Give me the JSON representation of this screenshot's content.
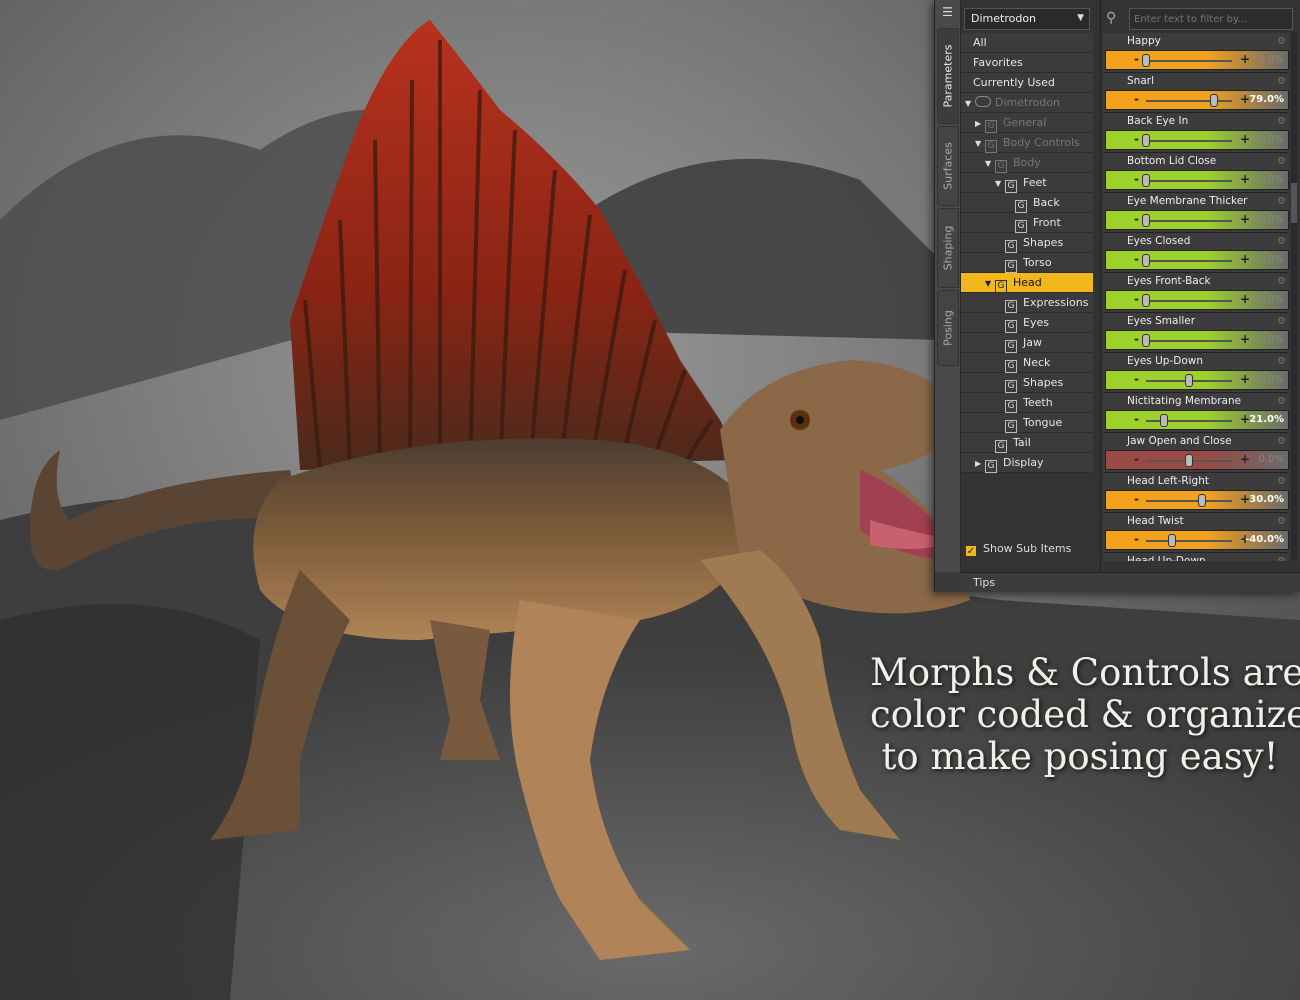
{
  "panel": {
    "tabs": [
      "Parameters",
      "Surfaces",
      "Shaping",
      "Posing"
    ],
    "figure_select": "Dimetrodon",
    "filter_placeholder": "Enter text to filter by...",
    "tree": [
      {
        "label": "All",
        "depth": 0,
        "arrow": "",
        "icon": "",
        "state": "normal"
      },
      {
        "label": "Favorites",
        "depth": 0,
        "arrow": "",
        "icon": "",
        "state": "normal"
      },
      {
        "label": "Currently Used",
        "depth": 0,
        "arrow": "",
        "icon": "",
        "state": "normal"
      },
      {
        "label": "Dimetrodon",
        "depth": 0,
        "arrow": "▼",
        "icon": "figure",
        "state": "dim"
      },
      {
        "label": "General",
        "depth": 1,
        "arrow": "▶",
        "icon": "group",
        "state": "dim"
      },
      {
        "label": "Body Controls",
        "depth": 1,
        "arrow": "▼",
        "icon": "group",
        "state": "dim"
      },
      {
        "label": "Body",
        "depth": 2,
        "arrow": "▼",
        "icon": "group",
        "state": "dim"
      },
      {
        "label": "Feet",
        "depth": 3,
        "arrow": "▼",
        "icon": "group",
        "state": "normal"
      },
      {
        "label": "Back",
        "depth": 4,
        "arrow": "",
        "icon": "group",
        "state": "normal"
      },
      {
        "label": "Front",
        "depth": 4,
        "arrow": "",
        "icon": "group",
        "state": "normal"
      },
      {
        "label": "Shapes",
        "depth": 3,
        "arrow": "",
        "icon": "group",
        "state": "normal"
      },
      {
        "label": "Torso",
        "depth": 3,
        "arrow": "",
        "icon": "group",
        "state": "normal"
      },
      {
        "label": "Head",
        "depth": 2,
        "arrow": "▼",
        "icon": "group",
        "state": "selected"
      },
      {
        "label": "Expressions",
        "depth": 3,
        "arrow": "",
        "icon": "group",
        "state": "normal"
      },
      {
        "label": "Eyes",
        "depth": 3,
        "arrow": "",
        "icon": "group",
        "state": "normal"
      },
      {
        "label": "Jaw",
        "depth": 3,
        "arrow": "",
        "icon": "group",
        "state": "normal"
      },
      {
        "label": "Neck",
        "depth": 3,
        "arrow": "",
        "icon": "group",
        "state": "normal"
      },
      {
        "label": "Shapes",
        "depth": 3,
        "arrow": "",
        "icon": "group",
        "state": "normal"
      },
      {
        "label": "Teeth",
        "depth": 3,
        "arrow": "",
        "icon": "group",
        "state": "normal"
      },
      {
        "label": "Tongue",
        "depth": 3,
        "arrow": "",
        "icon": "group",
        "state": "normal"
      },
      {
        "label": "Tail",
        "depth": 2,
        "arrow": "",
        "icon": "group",
        "state": "normal"
      },
      {
        "label": "Display",
        "depth": 1,
        "arrow": "▶",
        "icon": "group",
        "state": "normal"
      }
    ],
    "show_sub_items": "Show Sub Items",
    "tips": "Tips",
    "params": [
      {
        "name": "Happy",
        "value": "0.0%",
        "level": 0.0,
        "color": "orange"
      },
      {
        "name": "Snarl",
        "value": "79.0%",
        "level": 0.79,
        "color": "orange"
      },
      {
        "name": "Back Eye In",
        "value": "0.0%",
        "level": 0.0,
        "color": "green"
      },
      {
        "name": "Bottom Lid Close",
        "value": "0.0%",
        "level": 0.0,
        "color": "green"
      },
      {
        "name": "Eye Membrane Thicker",
        "value": "0.0%",
        "level": 0.0,
        "color": "green"
      },
      {
        "name": "Eyes Closed",
        "value": "0.0%",
        "level": 0.0,
        "color": "green"
      },
      {
        "name": "Eyes Front-Back",
        "value": "0.0%",
        "level": 0.0,
        "color": "green"
      },
      {
        "name": "Eyes Smaller",
        "value": "0.0%",
        "level": 0.0,
        "color": "green"
      },
      {
        "name": "Eyes Up-Down",
        "value": "0.0%",
        "level": 0.5,
        "color": "green"
      },
      {
        "name": "Nictitating Membrane",
        "value": "21.0%",
        "level": 0.21,
        "color": "green"
      },
      {
        "name": "Jaw Open and Close",
        "value": "0.0%",
        "level": 0.5,
        "color": "red"
      },
      {
        "name": "Head Left-Right",
        "value": "30.0%",
        "level": 0.65,
        "color": "orange"
      },
      {
        "name": "Head Twist",
        "value": "-40.0%",
        "level": 0.3,
        "color": "orange"
      },
      {
        "name": "Head Up-Down",
        "value": "",
        "level": 0.5,
        "color": "orange"
      }
    ]
  },
  "caption": [
    "Morphs & Controls are",
    "color coded & organized",
    "to make posing easy!"
  ],
  "colors": {
    "orange": "#f2a21c",
    "green": "#9ed12c",
    "red": "#9a4a44",
    "selected": "#f0b81a"
  }
}
